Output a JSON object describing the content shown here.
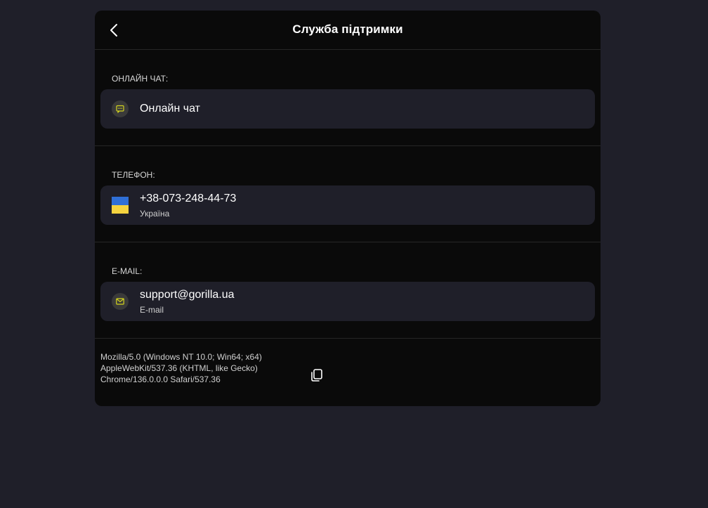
{
  "header": {
    "title": "Служба підтримки",
    "back_icon": "chevron-left-icon"
  },
  "sections": {
    "chat": {
      "label": "ОНЛАЙН ЧАТ:",
      "item_title": "Онлайн чат",
      "icon": "chat-bubble-icon"
    },
    "phone": {
      "label": "ТЕЛЕФОН:",
      "item_title": "+38-073-248-44-73",
      "item_subtitle": "Україна",
      "icon": "ukraine-flag-icon"
    },
    "email": {
      "label": "E-MAIL:",
      "item_title": "support@gorilla.ua",
      "item_subtitle": "E-mail",
      "icon": "envelope-icon"
    }
  },
  "footer": {
    "user_agent_line1": "Mozilla/5.0 (Windows NT 10.0; Win64; x64)",
    "user_agent_line2": "AppleWebKit/537.36 (KHTML, like Gecko)",
    "user_agent_line3": "Chrome/136.0.0.0 Safari/537.36",
    "copy_icon": "copy-icon"
  },
  "colors": {
    "page_background": "#1f1f29",
    "panel_background": "#0a0a0a",
    "card_background": "#1f1f29",
    "icon_accent": "#d4d41e",
    "flag_blue": "#2f6fd6",
    "flag_yellow": "#f5d33f"
  }
}
